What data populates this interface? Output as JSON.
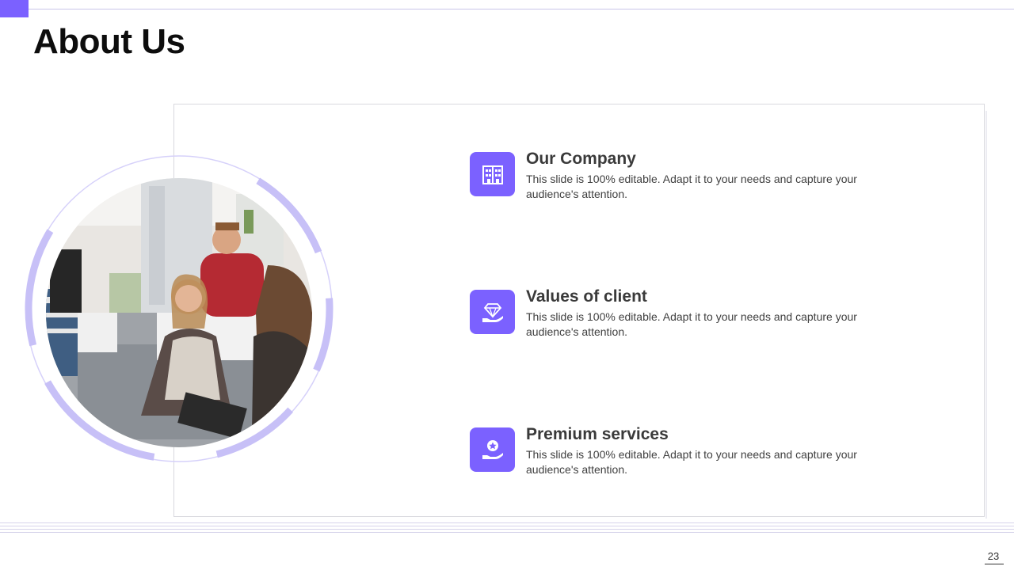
{
  "slide": {
    "title": "About Us",
    "page_number": "23"
  },
  "colors": {
    "accent": "#7b61ff",
    "ring": "#c7c0f7",
    "ring_thin": "#d6d1fa",
    "heading_text": "#3a3a3a",
    "body_text": "#404040"
  },
  "photo": {
    "icon": "team-meeting-photo"
  },
  "items": [
    {
      "icon": "building-icon",
      "heading": "Our Company",
      "description": "This slide is 100% editable. Adapt it to your needs and capture your audience's attention."
    },
    {
      "icon": "diamond-hand-icon",
      "heading": "Values of client",
      "description": "This slide is 100% editable. Adapt it to your needs and capture your audience's attention."
    },
    {
      "icon": "star-hand-icon",
      "heading": "Premium services",
      "description": "This slide is 100% editable. Adapt it to your needs and capture your audience's attention."
    }
  ]
}
